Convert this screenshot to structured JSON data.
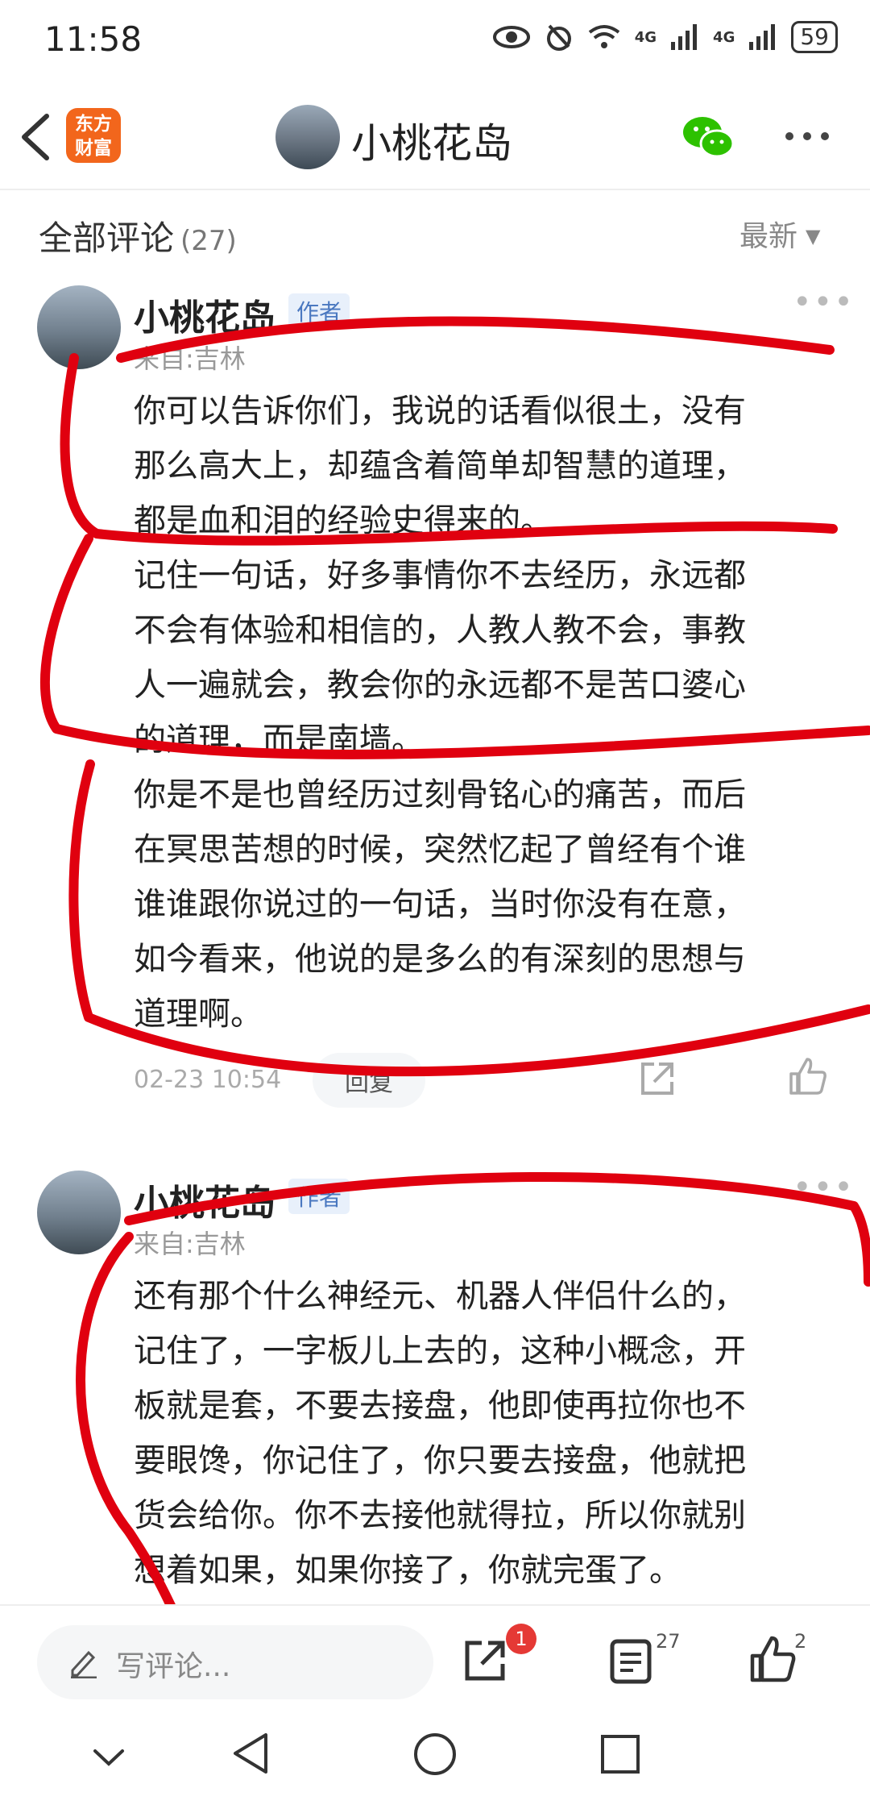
{
  "status": {
    "time": "11:58",
    "battery": "59",
    "net1": "4G",
    "net2": "4G"
  },
  "header": {
    "logo_line1": "东方",
    "logo_line2": "财富",
    "title": "小桃花岛"
  },
  "comments_header": {
    "label": "全部评论",
    "count": "(27)",
    "sort": "最新"
  },
  "comments": [
    {
      "author": "小桃花岛",
      "badge": "作者",
      "from": "来自:吉林",
      "text": "你可以告诉你们，我说的话看似很土，没有\n那么高大上，却蕴含着简单却智慧的道理，\n都是血和泪的经验史得来的。\n记住一句话，好多事情你不去经历，永远都\n不会有体验和相信的，人教人教不会，事教\n人一遍就会，教会你的永远都不是苦口婆心\n的道理，而是南墙。\n你是不是也曾经历过刻骨铭心的痛苦，而后\n在冥思苦想的时候，突然忆起了曾经有个谁\n谁谁跟你说过的一句话，当时你没有在意，\n如今看来，他说的是多么的有深刻的思想与\n道理啊。",
      "time": "02-23 10:54",
      "reply": "回复"
    },
    {
      "author": "小桃花岛",
      "badge": "作者",
      "from": "来自:吉林",
      "text": "还有那个什么神经元、机器人伴侣什么的，\n记住了，一字板儿上去的，这种小概念，开\n板就是套，不要去接盘，他即使再拉你也不\n要眼馋，你记住了，你只要去接盘，他就把\n货会给你。你不去接他就得拉，所以你就别\n想着如果，如果你接了，你就完蛋了。"
    }
  ],
  "bottom": {
    "placeholder": "写评论...",
    "share_badge": "1",
    "comment_count": "27",
    "like_count": "2"
  },
  "colors": {
    "logo": "#f2661c",
    "annotation": "#e0000f",
    "badge_red": "#e53935",
    "author_badge": "#4a78c0"
  }
}
